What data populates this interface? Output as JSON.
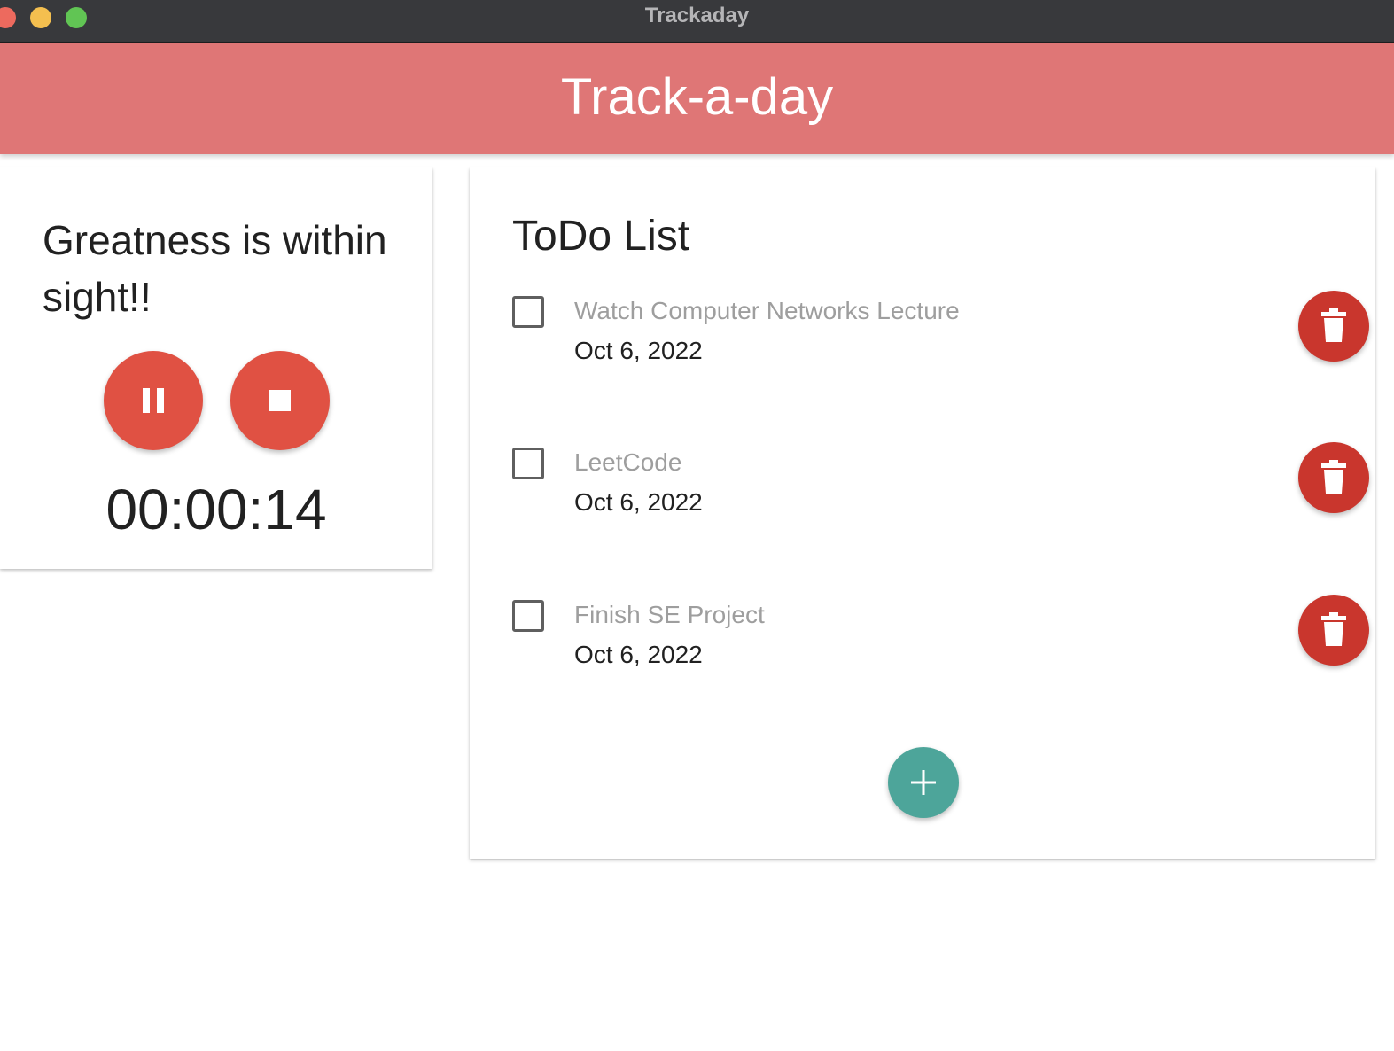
{
  "window": {
    "title": "Trackaday"
  },
  "header": {
    "title": "Track-a-day",
    "color": "#df7676"
  },
  "timer_panel": {
    "quote": "Greatness is within sight!!",
    "elapsed": "00:00:14",
    "buttons": [
      {
        "icon": "pause-icon",
        "color": "#e05143"
      },
      {
        "icon": "stop-icon",
        "color": "#e05143"
      }
    ]
  },
  "todo": {
    "title": "ToDo List",
    "items": [
      {
        "label": "Watch Computer Networks Lecture",
        "date": "Oct 6, 2022",
        "checked": false
      },
      {
        "label": "LeetCode",
        "date": "Oct 6, 2022",
        "checked": false
      },
      {
        "label": "Finish SE Project",
        "date": "Oct 6, 2022",
        "checked": false
      }
    ],
    "delete_icon": "trash-icon",
    "delete_color": "#c9362d",
    "add_icon": "plus-icon",
    "add_color": "#4da59a"
  }
}
